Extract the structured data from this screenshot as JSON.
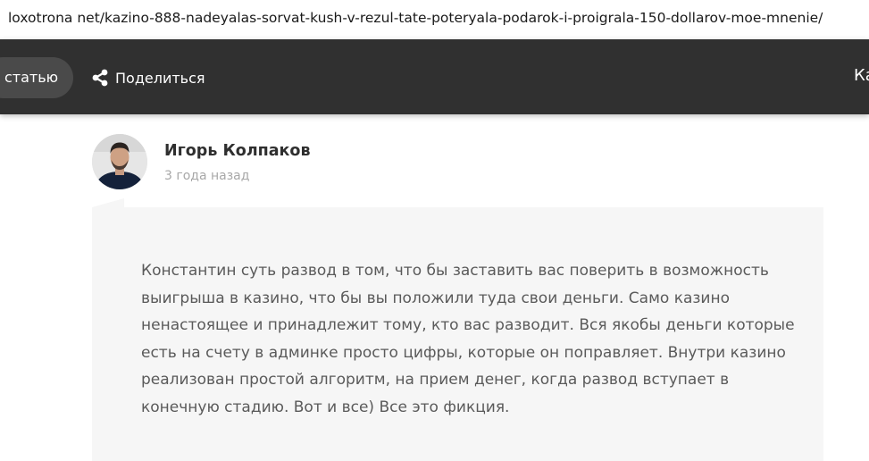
{
  "browser": {
    "url": "loxotrona net/kazino-888-nadeyalas-sorvat-kush-v-rezul-tate-poteryala-podarok-i-proigrala-150-dollarov-moe-mnenie/"
  },
  "nav": {
    "pill_label": "статью",
    "share_label": "Поделиться",
    "share_icon": "share-icon",
    "clipped_label": "Ка"
  },
  "comment": {
    "author": "Игорь Колпаков",
    "time": "3 года назад",
    "text": "Константин суть развод в том, что бы заставить вас поверить в возможность выигрыша в казино, что бы вы положили туда свои деньги. Само казино ненастоящее и принадлежит тому, кто вас разводит. Вся якобы деньги которые есть на счету в админке просто цифры, которые он поправляет. Внутри казино реализован простой алгоритм, на прием денег, когда развод вступает в конечную стадию. Вот и все) Все это фикция."
  },
  "colors": {
    "nav_background": "#303030",
    "comment_background": "#f6f6f6",
    "comment_text": "#5a5a5a",
    "author_text": "#2f2f2f",
    "time_text": "#a8a8a8"
  }
}
